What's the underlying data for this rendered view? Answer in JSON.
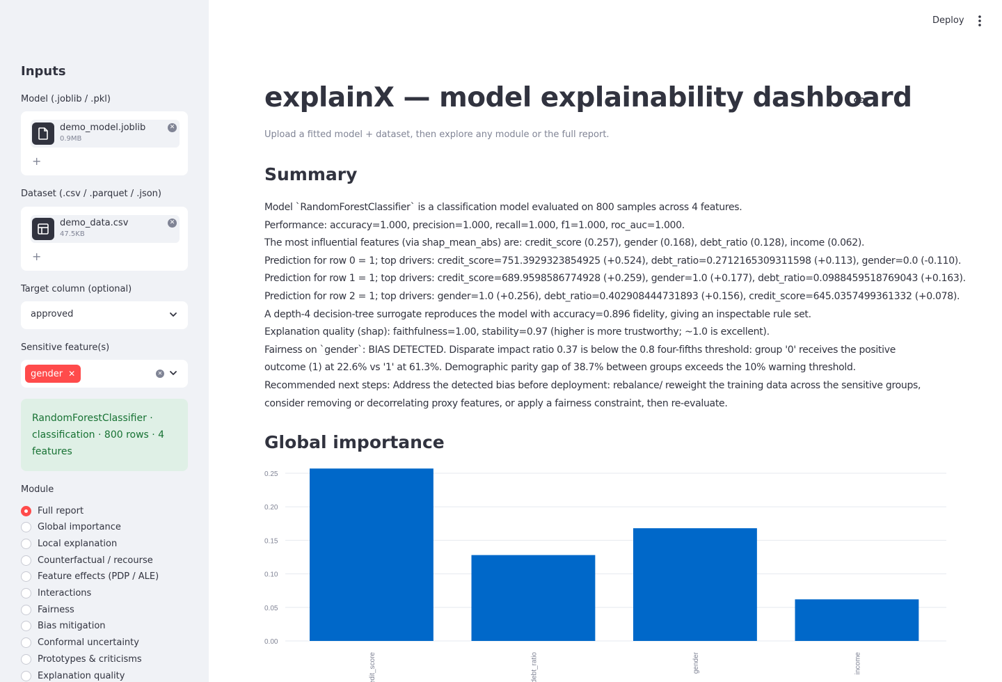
{
  "sidebar": {
    "title": "Inputs",
    "model": {
      "label": "Model (.joblib / .pkl)",
      "file_name": "demo_model.joblib",
      "file_size": "0.9MB",
      "add_symbol": "+"
    },
    "dataset": {
      "label": "Dataset (.csv / .parquet / .json)",
      "file_name": "demo_data.csv",
      "file_size": "47.5KB",
      "add_symbol": "+"
    },
    "target": {
      "label": "Target column (optional)",
      "value": "approved"
    },
    "sensitive": {
      "label": "Sensitive feature(s)",
      "tags": [
        "gender"
      ]
    },
    "info": "RandomForestClassifier · classification · 800 rows · 4 features",
    "module": {
      "label": "Module",
      "selected": "Full report",
      "options": [
        "Full report",
        "Global importance",
        "Local explanation",
        "Counterfactual / recourse",
        "Feature effects (PDP / ALE)",
        "Interactions",
        "Fairness",
        "Bias mitigation",
        "Conformal uncertainty",
        "Prototypes & criticisms",
        "Explanation quality"
      ]
    }
  },
  "header": {
    "deploy_label": "Deploy"
  },
  "main": {
    "title": "explainX — model explainability dashboard",
    "caption": "Upload a fitted model + dataset, then explore any module or the full report.",
    "summary_heading": "Summary",
    "summary_lines": [
      "Model `RandomForestClassifier` is a classification model evaluated on 800 samples across 4 features.",
      "Performance: accuracy=1.000, precision=1.000, recall=1.000, f1=1.000, roc_auc=1.000.",
      "The most influential features (via shap_mean_abs) are: credit_score (0.257), gender (0.168), debt_ratio (0.128), income (0.062).",
      "Prediction for row 0 = 1; top drivers: credit_score=751.3929323854925 (+0.524), debt_ratio=0.2712165309311598 (+0.113), gender=0.0 (-0.110).",
      "Prediction for row 1 = 1; top drivers: credit_score=689.9598586774928 (+0.259), gender=1.0 (+0.177), debt_ratio=0.0988459518769043 (+0.163).",
      "Prediction for row 2 = 1; top drivers: gender=1.0 (+0.256), debt_ratio=0.402908444731893 (+0.156), credit_score=645.0357499361332 (+0.078).",
      "A depth-4 decision-tree surrogate reproduces the model with accuracy=0.896 fidelity, giving an inspectable rule set.",
      "Explanation quality (shap): faithfulness=1.00, stability=0.97 (higher is more trustworthy; ~1.0 is excellent).",
      "Fairness on `gender`: BIAS DETECTED. Disparate impact ratio 0.37 is below the 0.8 four-fifths threshold: group '0' receives the positive",
      "outcome (1) at 22.6% vs '1' at 61.3%. Demographic parity gap of 38.7% between groups exceeds the 10% warning threshold.",
      "Recommended next steps: Address the detected bias before deployment: rebalance/ reweight the training data across the sensitive groups,",
      "consider removing or decorrelating proxy features, or apply a fairness constraint, then re-evaluate."
    ],
    "importance_heading": "Global importance"
  },
  "chart_data": {
    "type": "bar",
    "categories": [
      "credit_score",
      "debt_ratio",
      "gender",
      "income"
    ],
    "values": [
      0.257,
      0.128,
      0.168,
      0.062
    ],
    "ylim": [
      0,
      0.25
    ],
    "yticks": [
      "0.00",
      "0.05",
      "0.10",
      "0.15",
      "0.20",
      "0.25"
    ],
    "grid": true,
    "bar_color": "#0068c9"
  },
  "colors": {
    "accent": "#ff4b4b",
    "sidebar_bg": "#f0f2f6",
    "info_bg": "#dff0e6",
    "info_text": "#177233"
  }
}
